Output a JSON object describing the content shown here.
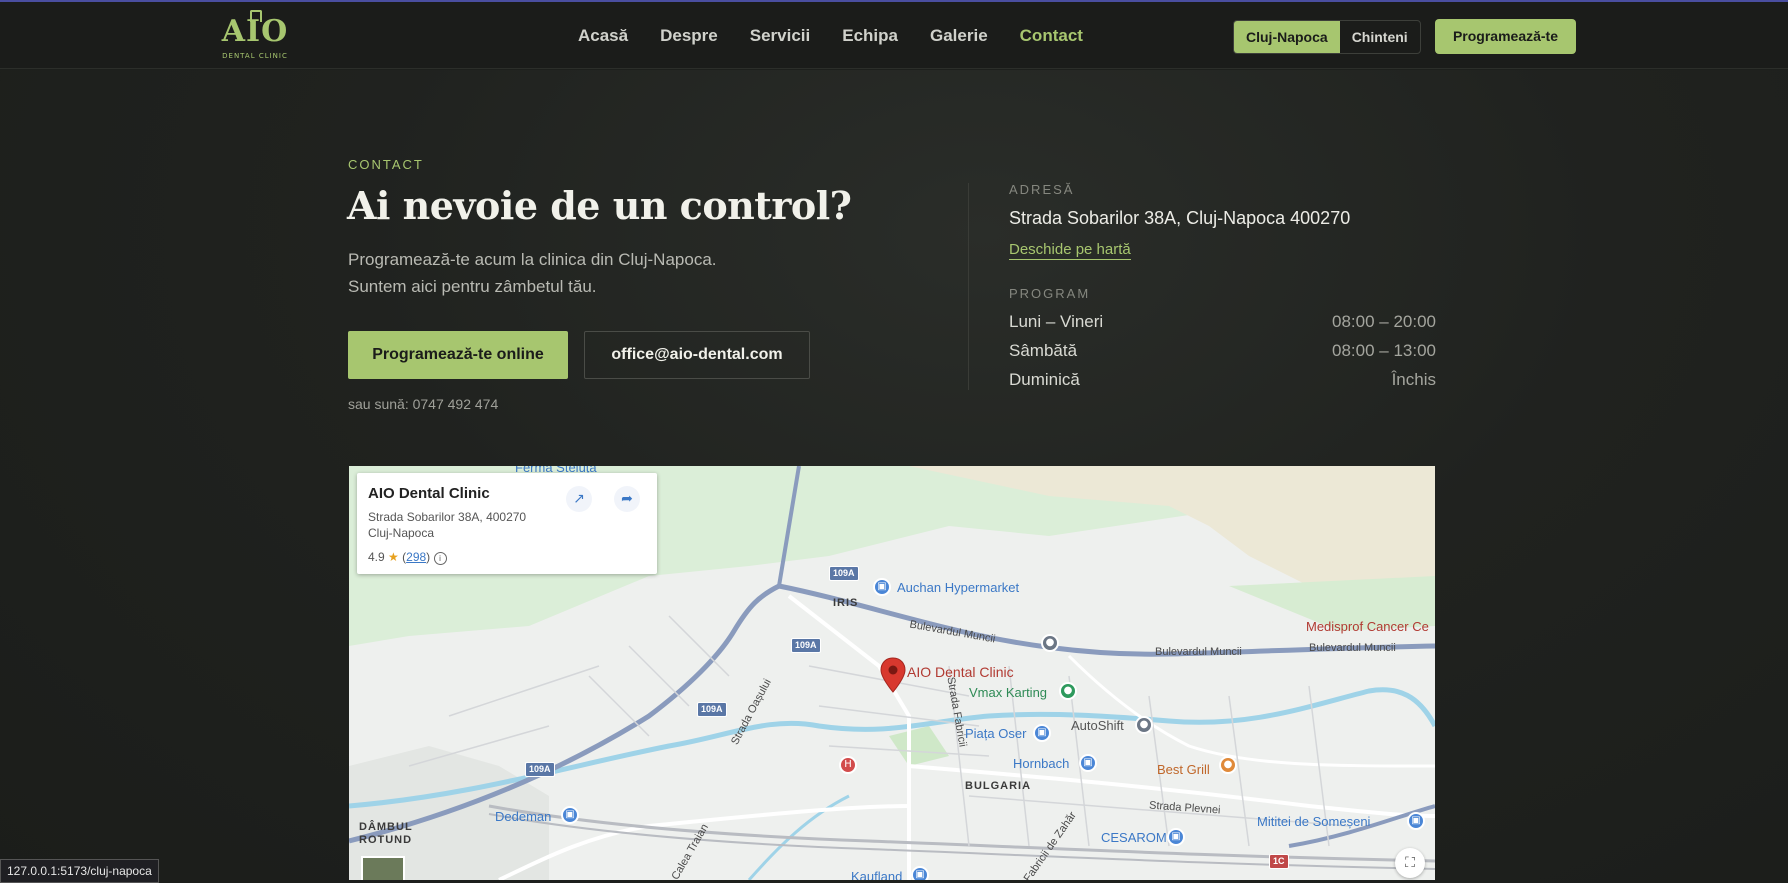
{
  "brand": {
    "logo_main": "AIO",
    "logo_sub": "DENTAL CLINIC",
    "accent_color": "#a7c66f"
  },
  "nav": {
    "links": [
      "Acasă",
      "Despre",
      "Servicii",
      "Echipa",
      "Galerie",
      "Contact"
    ],
    "active": "Contact",
    "cities": [
      "Cluj-Napoca",
      "Chinteni"
    ],
    "active_city": "Cluj-Napoca",
    "cta": "Programează-te"
  },
  "contact": {
    "eyebrow": "CONTACT",
    "headline": "Ai nevoie de un control?",
    "subtext_line1": "Programează-te acum la clinica din Cluj-Napoca.",
    "subtext_line2": "Suntem aici pentru zâmbetul tău.",
    "primary_button": "Programează-te online",
    "email_button": "office@aio-dental.com",
    "phone_line": "sau sună: 0747 492 474"
  },
  "info": {
    "address_label": "ADRESĂ",
    "address": "Strada Sobarilor 38A, Cluj-Napoca 400270",
    "map_link": "Deschide pe hartă",
    "program_label": "PROGRAM",
    "schedule": [
      {
        "day": "Luni – Vineri",
        "hours": "08:00 – 20:00"
      },
      {
        "day": "Sâmbătă",
        "hours": "08:00 – 13:00"
      },
      {
        "day": "Duminică",
        "hours": "Închis"
      }
    ]
  },
  "map": {
    "card": {
      "title": "AIO Dental Clinic",
      "address_line1": "Strada Sobarilor 38A, 400270",
      "address_line2": "Cluj-Napoca",
      "rating": "4.9",
      "reviews": "298"
    },
    "pin_label": "AIO Dental Clinic",
    "places": {
      "auchan": "Auchan Hypermarket",
      "medisprof": "Medisprof Cancer Ce",
      "vmax": "Vmax Karting",
      "autoshift": "AutoShift",
      "piata": "Piața Oser",
      "hornbach": "Hornbach",
      "bestgrill": "Best Grill",
      "dedeman": "Dedeman",
      "mititei": "Mititei de Someșeni",
      "cesarom": "CESAROM",
      "kaufland": "Kaufland",
      "ferma": "Ferma Steluța"
    },
    "districts": {
      "iris": "IRIS",
      "bulgaria": "BULGARIA",
      "dambul1": "DÂMBUL",
      "dambul2": "ROTUND"
    },
    "streets": {
      "muncii1": "Bulevardul Muncii",
      "muncii2": "Bulevardul Muncii",
      "muncii3": "Bulevardul Muncii",
      "oasului": "Strada Oașului",
      "fabricii": "Strada Fabricii",
      "plevnei": "Strada Plevnei",
      "traian": "Calea Traian",
      "zahar": "Fabricii de Zahăr"
    },
    "shields": [
      "109A",
      "109A",
      "109A",
      "109A",
      "1C"
    ]
  },
  "status_bar": {
    "url": "127.0.0.1:5173/cluj-napoca"
  }
}
